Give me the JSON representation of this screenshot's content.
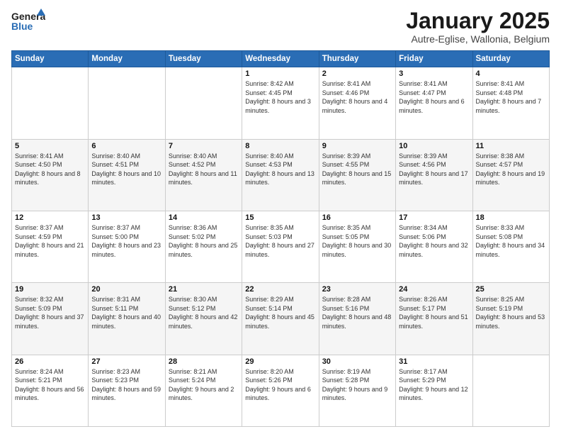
{
  "header": {
    "logo_line1": "General",
    "logo_line2": "Blue",
    "title": "January 2025",
    "subtitle": "Autre-Eglise, Wallonia, Belgium"
  },
  "days_of_week": [
    "Sunday",
    "Monday",
    "Tuesday",
    "Wednesday",
    "Thursday",
    "Friday",
    "Saturday"
  ],
  "weeks": [
    [
      {
        "day": "",
        "info": ""
      },
      {
        "day": "",
        "info": ""
      },
      {
        "day": "",
        "info": ""
      },
      {
        "day": "1",
        "info": "Sunrise: 8:42 AM\nSunset: 4:45 PM\nDaylight: 8 hours and 3 minutes."
      },
      {
        "day": "2",
        "info": "Sunrise: 8:41 AM\nSunset: 4:46 PM\nDaylight: 8 hours and 4 minutes."
      },
      {
        "day": "3",
        "info": "Sunrise: 8:41 AM\nSunset: 4:47 PM\nDaylight: 8 hours and 6 minutes."
      },
      {
        "day": "4",
        "info": "Sunrise: 8:41 AM\nSunset: 4:48 PM\nDaylight: 8 hours and 7 minutes."
      }
    ],
    [
      {
        "day": "5",
        "info": "Sunrise: 8:41 AM\nSunset: 4:50 PM\nDaylight: 8 hours and 8 minutes."
      },
      {
        "day": "6",
        "info": "Sunrise: 8:40 AM\nSunset: 4:51 PM\nDaylight: 8 hours and 10 minutes."
      },
      {
        "day": "7",
        "info": "Sunrise: 8:40 AM\nSunset: 4:52 PM\nDaylight: 8 hours and 11 minutes."
      },
      {
        "day": "8",
        "info": "Sunrise: 8:40 AM\nSunset: 4:53 PM\nDaylight: 8 hours and 13 minutes."
      },
      {
        "day": "9",
        "info": "Sunrise: 8:39 AM\nSunset: 4:55 PM\nDaylight: 8 hours and 15 minutes."
      },
      {
        "day": "10",
        "info": "Sunrise: 8:39 AM\nSunset: 4:56 PM\nDaylight: 8 hours and 17 minutes."
      },
      {
        "day": "11",
        "info": "Sunrise: 8:38 AM\nSunset: 4:57 PM\nDaylight: 8 hours and 19 minutes."
      }
    ],
    [
      {
        "day": "12",
        "info": "Sunrise: 8:37 AM\nSunset: 4:59 PM\nDaylight: 8 hours and 21 minutes."
      },
      {
        "day": "13",
        "info": "Sunrise: 8:37 AM\nSunset: 5:00 PM\nDaylight: 8 hours and 23 minutes."
      },
      {
        "day": "14",
        "info": "Sunrise: 8:36 AM\nSunset: 5:02 PM\nDaylight: 8 hours and 25 minutes."
      },
      {
        "day": "15",
        "info": "Sunrise: 8:35 AM\nSunset: 5:03 PM\nDaylight: 8 hours and 27 minutes."
      },
      {
        "day": "16",
        "info": "Sunrise: 8:35 AM\nSunset: 5:05 PM\nDaylight: 8 hours and 30 minutes."
      },
      {
        "day": "17",
        "info": "Sunrise: 8:34 AM\nSunset: 5:06 PM\nDaylight: 8 hours and 32 minutes."
      },
      {
        "day": "18",
        "info": "Sunrise: 8:33 AM\nSunset: 5:08 PM\nDaylight: 8 hours and 34 minutes."
      }
    ],
    [
      {
        "day": "19",
        "info": "Sunrise: 8:32 AM\nSunset: 5:09 PM\nDaylight: 8 hours and 37 minutes."
      },
      {
        "day": "20",
        "info": "Sunrise: 8:31 AM\nSunset: 5:11 PM\nDaylight: 8 hours and 40 minutes."
      },
      {
        "day": "21",
        "info": "Sunrise: 8:30 AM\nSunset: 5:12 PM\nDaylight: 8 hours and 42 minutes."
      },
      {
        "day": "22",
        "info": "Sunrise: 8:29 AM\nSunset: 5:14 PM\nDaylight: 8 hours and 45 minutes."
      },
      {
        "day": "23",
        "info": "Sunrise: 8:28 AM\nSunset: 5:16 PM\nDaylight: 8 hours and 48 minutes."
      },
      {
        "day": "24",
        "info": "Sunrise: 8:26 AM\nSunset: 5:17 PM\nDaylight: 8 hours and 51 minutes."
      },
      {
        "day": "25",
        "info": "Sunrise: 8:25 AM\nSunset: 5:19 PM\nDaylight: 8 hours and 53 minutes."
      }
    ],
    [
      {
        "day": "26",
        "info": "Sunrise: 8:24 AM\nSunset: 5:21 PM\nDaylight: 8 hours and 56 minutes."
      },
      {
        "day": "27",
        "info": "Sunrise: 8:23 AM\nSunset: 5:23 PM\nDaylight: 8 hours and 59 minutes."
      },
      {
        "day": "28",
        "info": "Sunrise: 8:21 AM\nSunset: 5:24 PM\nDaylight: 9 hours and 2 minutes."
      },
      {
        "day": "29",
        "info": "Sunrise: 8:20 AM\nSunset: 5:26 PM\nDaylight: 9 hours and 6 minutes."
      },
      {
        "day": "30",
        "info": "Sunrise: 8:19 AM\nSunset: 5:28 PM\nDaylight: 9 hours and 9 minutes."
      },
      {
        "day": "31",
        "info": "Sunrise: 8:17 AM\nSunset: 5:29 PM\nDaylight: 9 hours and 12 minutes."
      },
      {
        "day": "",
        "info": ""
      }
    ]
  ]
}
